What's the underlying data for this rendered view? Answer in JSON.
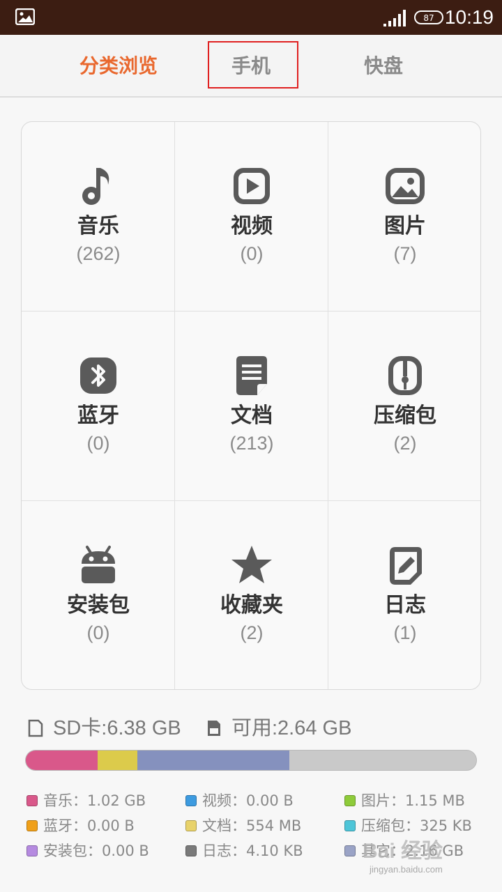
{
  "status_bar": {
    "time": "10:19",
    "battery_label": "87"
  },
  "tabs": [
    {
      "label": "分类浏览",
      "active": true
    },
    {
      "label": "手机",
      "active": false
    },
    {
      "label": "快盘",
      "active": false
    }
  ],
  "categories": [
    {
      "label": "音乐",
      "count": "(262)",
      "icon": "music-note-icon"
    },
    {
      "label": "视频",
      "count": "(0)",
      "icon": "video-play-icon"
    },
    {
      "label": "图片",
      "count": "(7)",
      "icon": "picture-icon"
    },
    {
      "label": "蓝牙",
      "count": "(0)",
      "icon": "bluetooth-icon"
    },
    {
      "label": "文档",
      "count": "(213)",
      "icon": "document-icon"
    },
    {
      "label": "压缩包",
      "count": "(2)",
      "icon": "zip-icon"
    },
    {
      "label": "安装包",
      "count": "(0)",
      "icon": "android-icon"
    },
    {
      "label": "收藏夹",
      "count": "(2)",
      "icon": "star-icon"
    },
    {
      "label": "日志",
      "count": "(1)",
      "icon": "log-edit-icon"
    }
  ],
  "storage": {
    "sd_text": "SD卡:6.38 GB",
    "free_text": "可用:2.64 GB",
    "usage_fractions": [
      {
        "name": "音乐",
        "fraction": 0.16,
        "color": "#d9588a"
      },
      {
        "name": "文档",
        "fraction": 0.087,
        "color": "#dccb4b"
      },
      {
        "name": "其它",
        "fraction": 0.338,
        "color": "#8591be"
      }
    ]
  },
  "legend": [
    {
      "text": "音乐：1.02 GB",
      "color": "#d9588a"
    },
    {
      "text": "视频：0.00 B",
      "color": "#3d9be0"
    },
    {
      "text": "图片：1.15 MB",
      "color": "#8ecb3a"
    },
    {
      "text": "蓝牙：0.00 B",
      "color": "#f0a01a"
    },
    {
      "text": "文档：554 MB",
      "color": "#e8d26a"
    },
    {
      "text": "压缩包：325 KB",
      "color": "#4ec5d8"
    },
    {
      "text": "安装包：0.00 B",
      "color": "#b58ae0"
    },
    {
      "text": "日志：4.10 KB",
      "color": "#7a7a7a"
    },
    {
      "text": "其它：2.16 GB",
      "color": "#9aa3c6"
    }
  ],
  "watermark": {
    "brand": "Bai 经验",
    "url": "jingyan.baidu.com"
  }
}
